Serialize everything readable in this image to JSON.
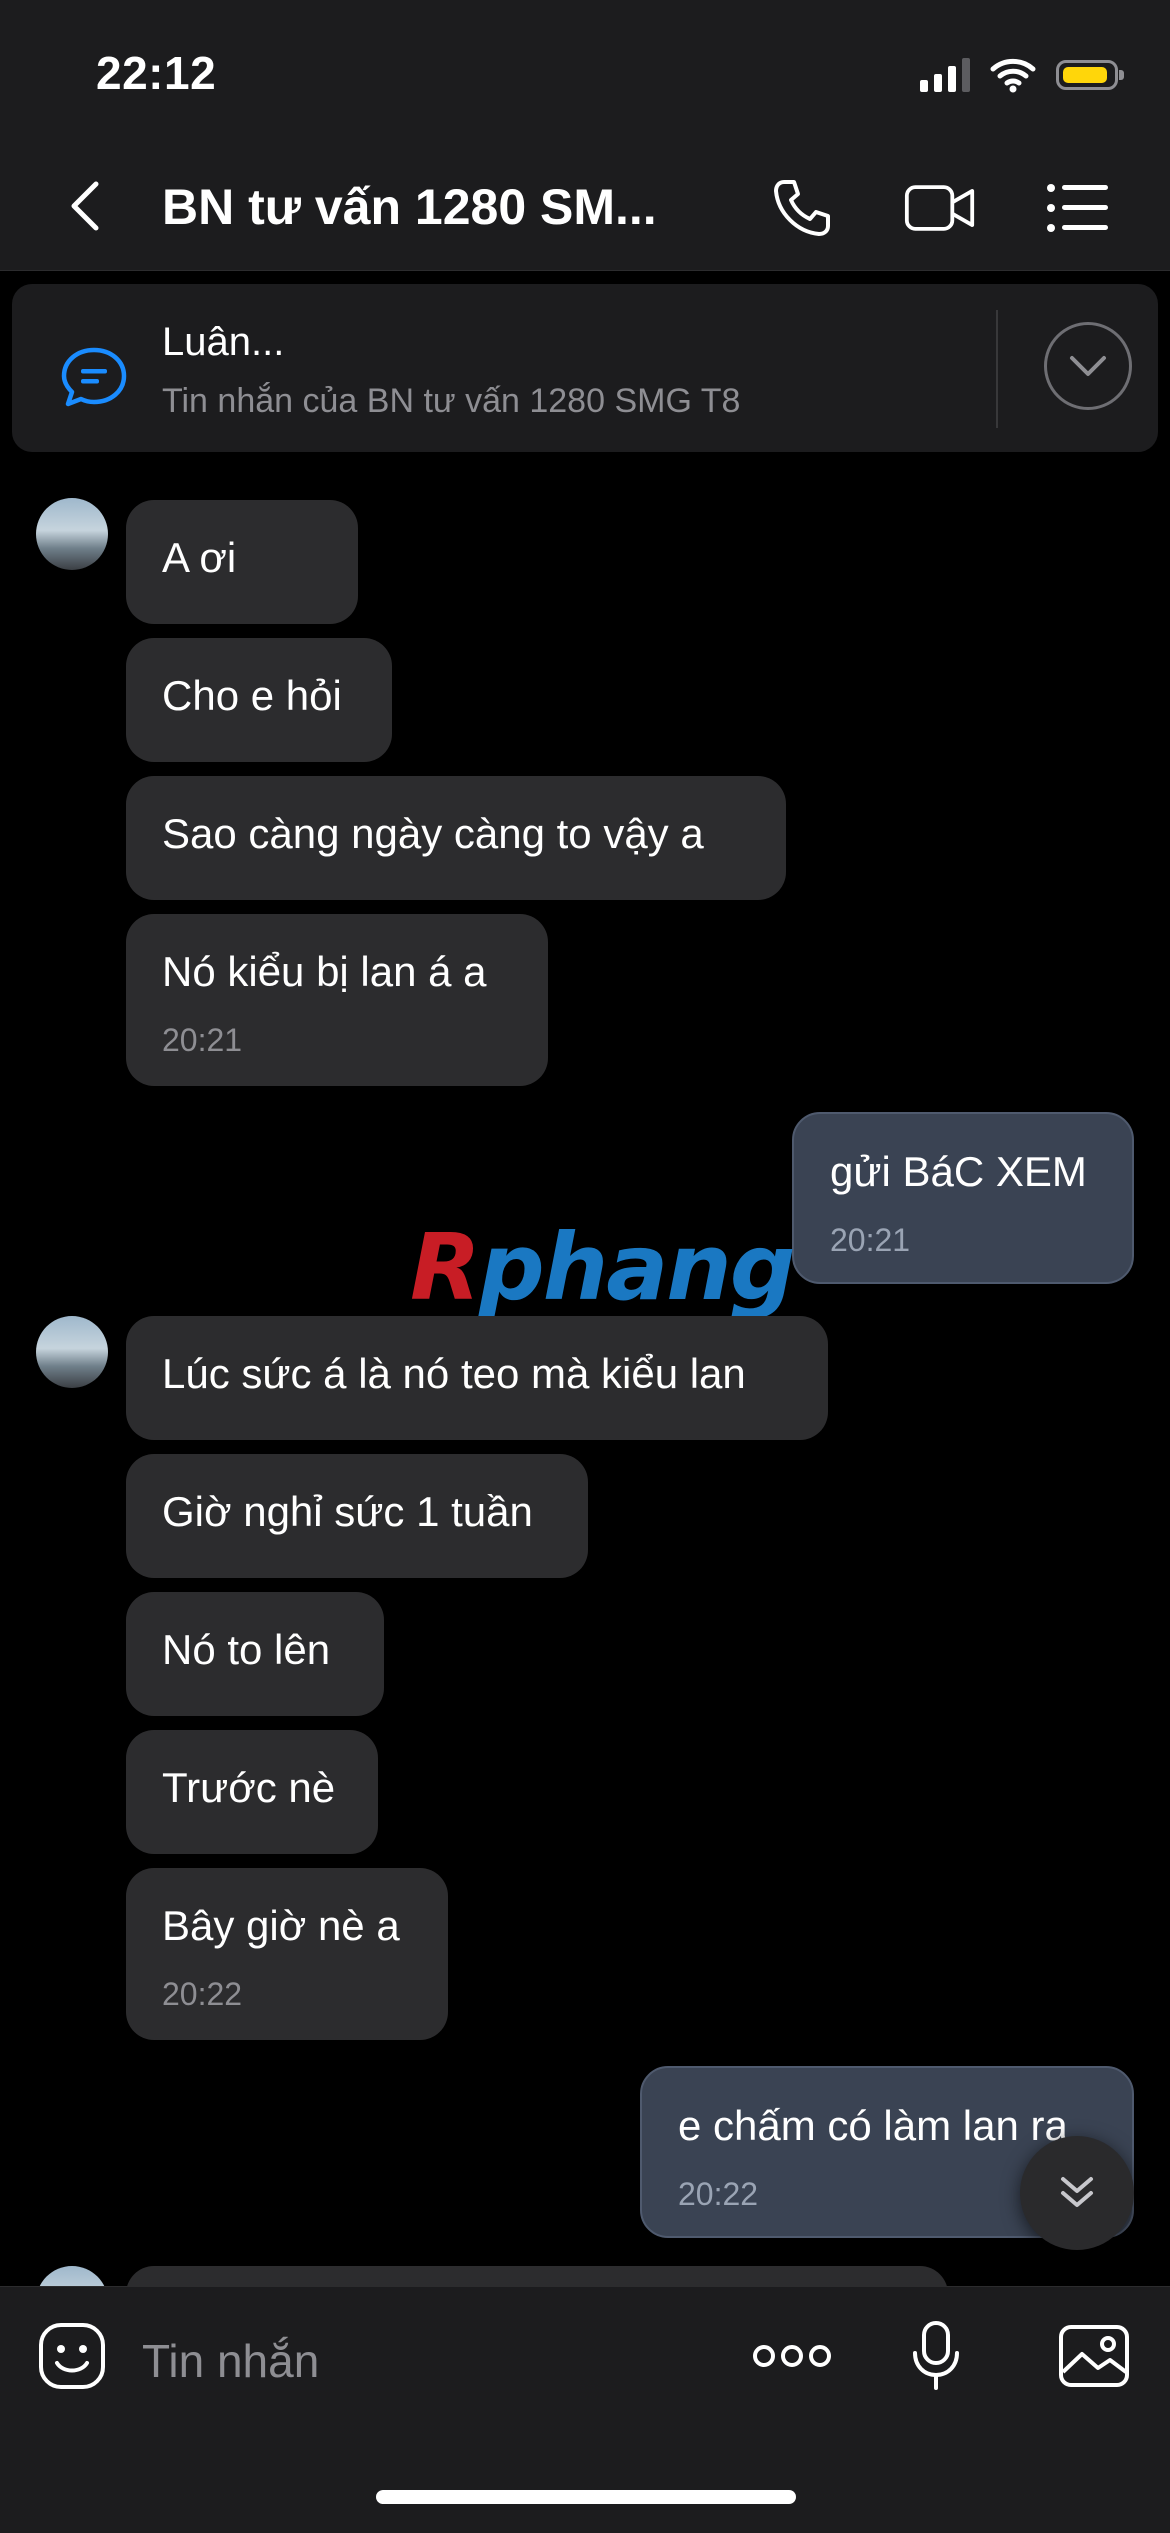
{
  "status_bar": {
    "time": "22:12"
  },
  "header": {
    "title": "BN tư vấn 1280 SM..."
  },
  "pinned": {
    "title": "Luân...",
    "subtitle": "Tin nhắn của BN tư vấn 1280 SMG T8"
  },
  "messages": [
    {
      "side": "in",
      "text": "A ơi"
    },
    {
      "side": "in",
      "text": "Cho e hỏi"
    },
    {
      "side": "in",
      "text": "Sao càng ngày càng to vậy a"
    },
    {
      "side": "in",
      "text": "Nó kiểu bị lan á a",
      "time": "20:21"
    },
    {
      "side": "out",
      "text": "gửi BáC XEM",
      "time": "20:21"
    },
    {
      "side": "in",
      "text": "Lúc sức á là nó teo mà kiểu lan"
    },
    {
      "side": "in",
      "text": "Giờ nghỉ sức 1 tuần"
    },
    {
      "side": "in",
      "text": "Nó to lên"
    },
    {
      "side": "in",
      "text": "Trước nè"
    },
    {
      "side": "in",
      "text": "Bây giờ nè a",
      "time": "20:22"
    },
    {
      "side": "out",
      "text": "e chấm có làm lan ra",
      "time": "20:22"
    }
  ],
  "watermark": {
    "first_letter": "R",
    "rest": "phang"
  },
  "composer": {
    "placeholder": "Tin nhắn"
  },
  "colors": {
    "incoming_bubble": "#2c2c2e",
    "outgoing_bubble": "#3a4353",
    "battery": "#ffd60a",
    "accent_blue": "#1a8cff"
  }
}
